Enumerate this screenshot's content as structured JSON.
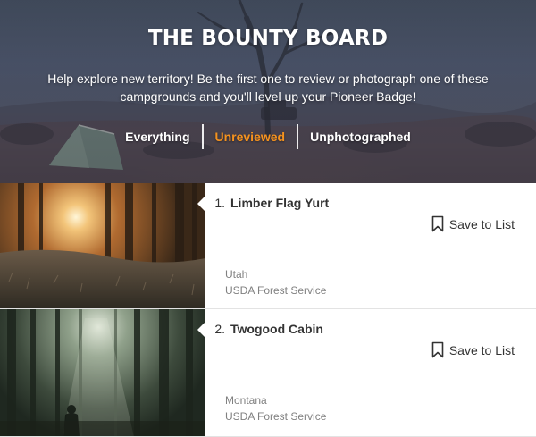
{
  "hero": {
    "title": "THE BOUNTY BOARD",
    "subtitle": "Help explore new territory! Be the first one to review or photograph one of these campgrounds and you'll level up your Pioneer Badge!",
    "filters": [
      {
        "label": "Everything",
        "active": false
      },
      {
        "label": "Unreviewed",
        "active": true
      },
      {
        "label": "Unphotographed",
        "active": false
      }
    ],
    "active_color": "#f5921e"
  },
  "campgrounds": [
    {
      "number": "1.",
      "name": "Limber Flag Yurt",
      "state": "Utah",
      "agency": "USDA Forest Service",
      "save_label": "Save to List",
      "photo": "sunlit-forest-photo"
    },
    {
      "number": "2.",
      "name": "Twogood Cabin",
      "state": "Montana",
      "agency": "USDA Forest Service",
      "save_label": "Save to List",
      "photo": "misty-forest-photo"
    }
  ]
}
